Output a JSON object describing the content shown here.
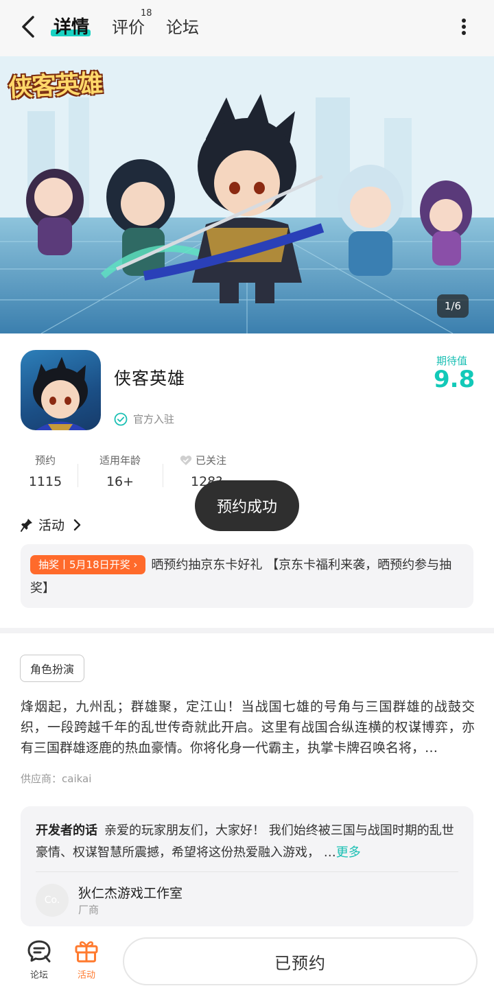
{
  "header": {
    "tabs": [
      {
        "label": "详情",
        "active": true
      },
      {
        "label": "评价",
        "badge": "18"
      },
      {
        "label": "论坛"
      }
    ],
    "accent_color": "#19d2c2"
  },
  "banner": {
    "logo_text": "侠客英雄",
    "page_indicator": "1/6"
  },
  "app": {
    "name": "侠客英雄",
    "official_label": "官方入驻",
    "score_label": "期待值",
    "score_value": "9.8"
  },
  "stats": {
    "reservations_label": "预约",
    "reservations_value": "1115",
    "age_label": "适用年龄",
    "age_value": "16+",
    "follow_label": "已关注",
    "follow_value": "128?"
  },
  "toast": {
    "text": "预约成功"
  },
  "activity": {
    "title": "活动",
    "tag": "抽奖丨5月18日开奖 ›",
    "text": "晒预约抽京东卡好礼 【京东卡福利来袭，晒预约参与抽奖】"
  },
  "description": {
    "genre_tag": "角色扮演",
    "text": "烽烟起，九州乱；群雄聚，定江山！当战国七雄的号角与三国群雄的战鼓交织，一段跨越千年的乱世传奇就此开启。这里有战国合纵连横的权谋博弈，亦有三国群雄逐鹿的热血豪情。你将化身一代霸主，执掌卡牌召唤名将，…",
    "supplier": "供应商：caikai"
  },
  "developer": {
    "label": "开发者的话",
    "text": "亲爱的玩家朋友们，大家好！ 我们始终被三国与战国时期的乱世豪情、权谋智慧所震撼，希望将这份热爱融入游戏， …",
    "more": "更多",
    "avatar_text": "Co.",
    "studio_name": "狄仁杰游戏工作室",
    "studio_role": "厂商"
  },
  "bottom_bar": {
    "forum_label": "论坛",
    "activity_label": "活动",
    "reserved_label": "已预约"
  }
}
